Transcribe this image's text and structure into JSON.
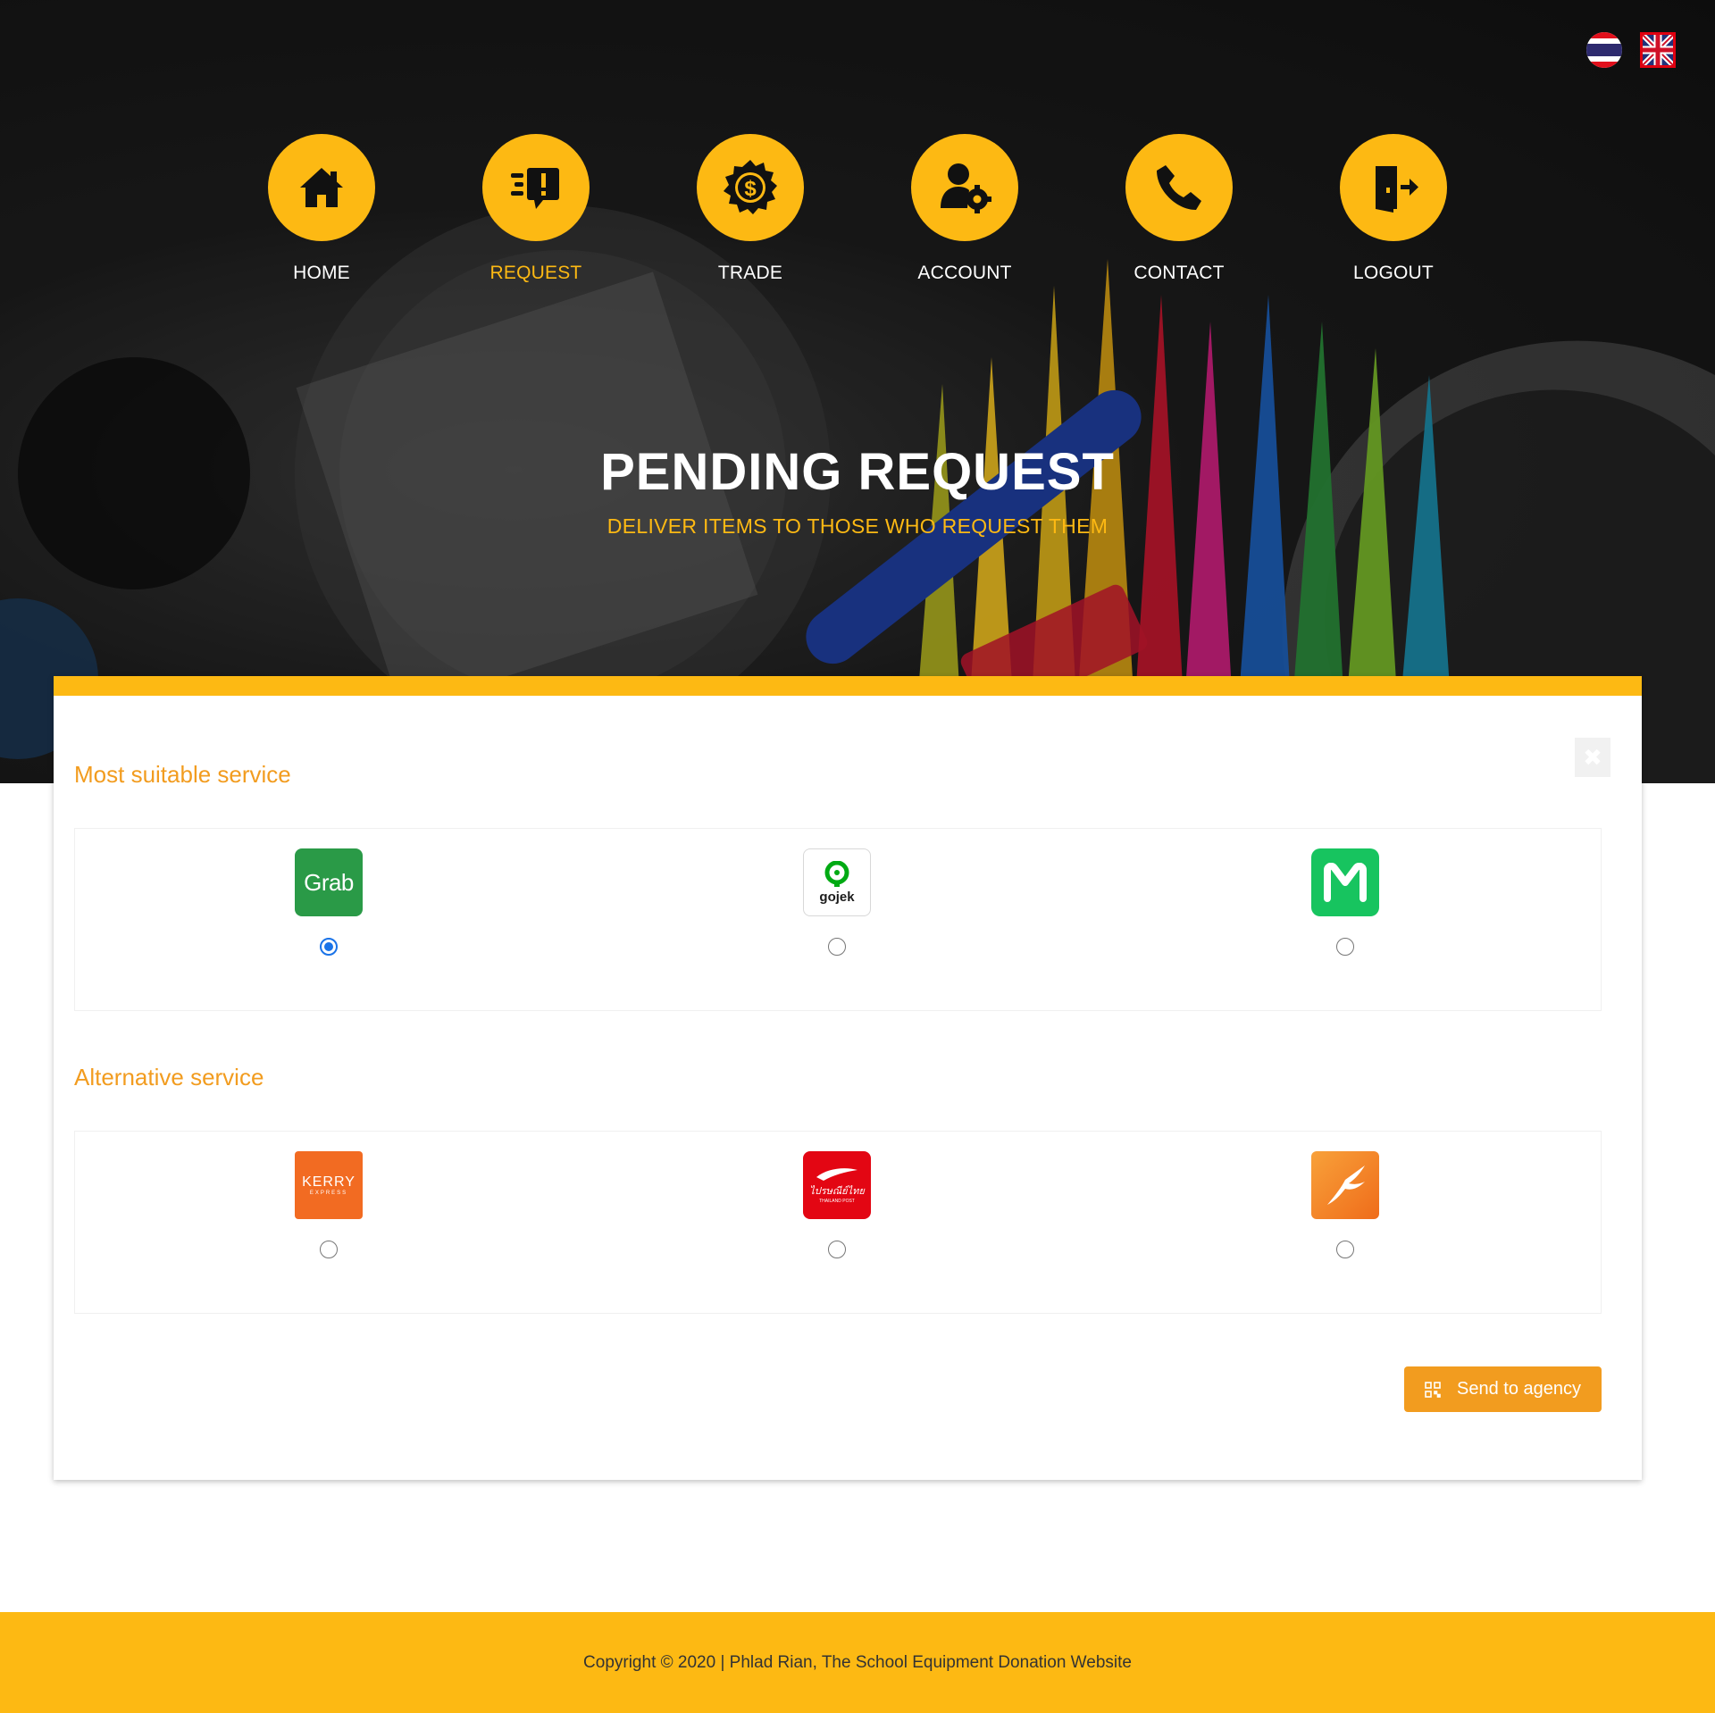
{
  "header": {
    "languages": [
      {
        "name": "thai",
        "icon": "thai-flag-icon"
      },
      {
        "name": "english",
        "icon": "uk-flag-icon",
        "selected": true
      }
    ],
    "nav": [
      {
        "label": "HOME",
        "icon": "home-icon",
        "active": false
      },
      {
        "label": "REQUEST",
        "icon": "request-icon",
        "active": true
      },
      {
        "label": "TRADE",
        "icon": "dollar-badge-icon",
        "active": false
      },
      {
        "label": "ACCOUNT",
        "icon": "user-gear-icon",
        "active": false
      },
      {
        "label": "CONTACT",
        "icon": "phone-icon",
        "active": false
      },
      {
        "label": "LOGOUT",
        "icon": "logout-door-icon",
        "active": false
      }
    ],
    "title": "PENDING REQUEST",
    "subtitle": "DELIVER ITEMS TO THOSE WHO REQUEST THEM"
  },
  "card": {
    "close_icon": "close-icon",
    "most_suitable_title": "Most suitable service",
    "alternative_title": "Alternative service",
    "most_suitable": [
      {
        "name": "grab",
        "logo_text": "Grab",
        "color": "#2a9a47",
        "selected": true
      },
      {
        "name": "gojek",
        "logo_text": "gojek",
        "color": "#00aa13",
        "selected": false
      },
      {
        "name": "lineman",
        "logo_text": "M",
        "color": "#17c45f",
        "selected": false
      }
    ],
    "alternative": [
      {
        "name": "kerry-express",
        "logo_text": "KERRY",
        "logo_subtext": "EXPRESS",
        "color": "#f26b22",
        "selected": false
      },
      {
        "name": "thailand-post",
        "logo_text": "ไปรษณีย์ไทย",
        "logo_subtext": "THAILAND POST",
        "color": "#e30613",
        "selected": false
      },
      {
        "name": "bird-delivery",
        "logo_text": "",
        "color": "#f5821f",
        "selected": false
      }
    ],
    "send_button": {
      "label": "Send to agency",
      "icon": "qr-code-icon"
    }
  },
  "footer": {
    "text": "Copyright © 2020 | Phlad Rian, The School Equipment Donation Website"
  },
  "colors": {
    "accent": "#fdb913",
    "heading": "#f29c1f",
    "radio_selected": "#1a73e8"
  }
}
